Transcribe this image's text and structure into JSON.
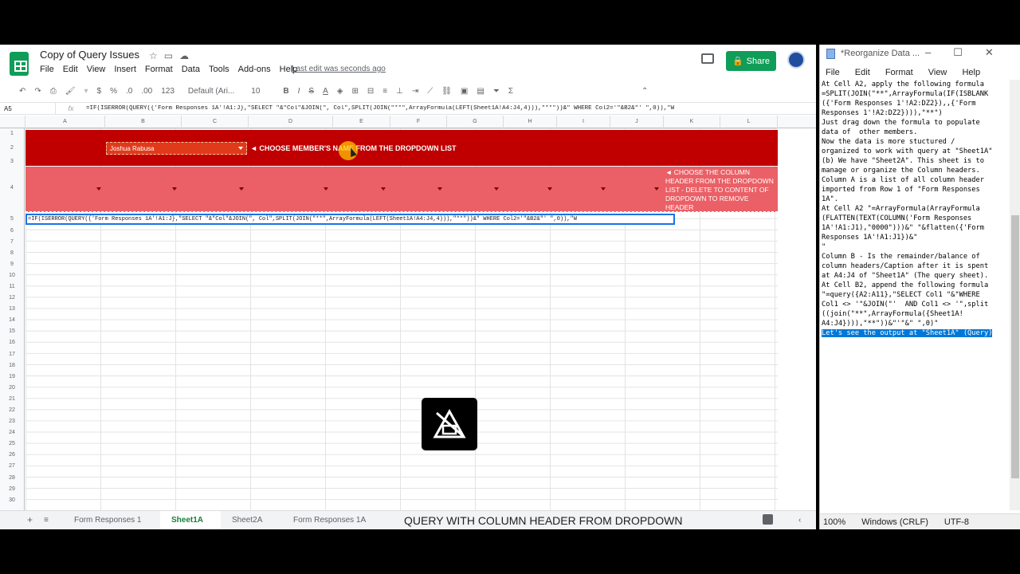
{
  "sheets": {
    "title": "Copy of Query Issues",
    "menu": [
      "File",
      "Edit",
      "View",
      "Insert",
      "Format",
      "Data",
      "Tools",
      "Add-ons",
      "Help"
    ],
    "last_edit": "Last edit was seconds ago",
    "share_label": "Share",
    "toolbar": {
      "font": "Default (Ari...",
      "size": "10",
      "currency": "$",
      "percent": "%",
      "dec_dec": ".0",
      "dec_inc": ".00",
      "format": "123"
    },
    "name_box": "A5",
    "formula": "=IF(ISERROR(QUERY({'Form Responses 1A'!A1:J},\"SELECT \"&\"Col\"&JOIN(\", Col\",SPLIT(JOIN(\"**\",ArrayFormula(LEFT(Sheet1A!A4:J4,4))),\"**\"))&\" WHERE Col2='\"&B2&\"' \",0)),\"W",
    "columns": [
      "A",
      "B",
      "C",
      "D",
      "E",
      "F",
      "G",
      "H",
      "I",
      "J",
      "K",
      "L"
    ],
    "rows": [
      "1",
      "2",
      "3",
      "4",
      "5",
      "6",
      "7",
      "8",
      "9",
      "10",
      "11",
      "12",
      "13",
      "14",
      "15",
      "16",
      "17",
      "18",
      "19",
      "20",
      "21",
      "22",
      "23",
      "24",
      "25",
      "26",
      "27",
      "28",
      "29",
      "30"
    ],
    "dropdown_value": "Joshua Rabusa",
    "instruction_member": "◄  CHOOSE MEMBER'S NAME FROM THE DROPDOWN LIST",
    "instruction_header": "◄  CHOOSE THE COLUMN HEADER FROM THE DROPDOWN LIST - DELETE TO CONTENT OF DROPDOWN TO REMOVE HEADER",
    "cell_a5": "=IF(ISERROR(QUERY({'Form Responses 1A'!A1:J},\"SELECT \"&\"Col\"&JOIN(\", Col\",SPLIT(JOIN(\"**\",ArrayFormula(LEFT(Sheet1A!A4:J4,4))),\"**\"))&\" WHERE Col2='\"&B2&\"' \",0)),\"W",
    "tabs": [
      "Form Responses 1",
      "Sheet1A",
      "Sheet2A",
      "Form Responses 1A"
    ],
    "active_tab": "Sheet1A",
    "caption": "QUERY WITH COLUMN HEADER FROM DROPDOWN"
  },
  "notepad": {
    "title": "*Reorganize Data ...",
    "menu": [
      "File",
      "Edit",
      "Format",
      "View",
      "Help"
    ],
    "lines": [
      "At Cell A2, apply the following formula",
      "",
      "=SPLIT(JOIN(\"**\",ArrayFormula(IF(ISBLANK",
      "({'Form Responses 1'!A2:DZ2}),,{'Form",
      "Responses 1'!A2:DZ2}))),\"**\")",
      "",
      "Just drag down the formula to populate",
      "data of  other members.",
      "",
      "Now the data is more stuctured /",
      "organized to work with query at \"Sheet1A\"",
      "",
      "(b) We have \"Sheet2A\". This sheet is to",
      "manage or organize the Column headers.",
      "Column A is a list of all column header",
      "imported from Row 1 of \"Form Responses",
      "1A\".",
      "",
      "At Cell A2 \"=ArrayFormula(ArrayFormula",
      "(FLATTEN(TEXT(COLUMN('Form Responses",
      "1A'!A1:J1),\"0000\")))&\" \"&flatten({'Form",
      "Responses 1A'!A1:J1})&\"",
      "\"",
      "",
      "Column B - Is the remainder/balance of",
      "column headers/Caption after it is spent",
      "at A4:J4 of \"Sheet1A\" (The query sheet).",
      "At Cell B2, append the following formula",
      "",
      "\"=query({A2:A11},\"SELECT Col1 \"&\"WHERE",
      "Col1 <> '\"&JOIN(\"'  AND Col1 <> '\",split",
      "((join(\"**\",ArrayFormula({Sheet1A!",
      "A4:J4}))),\"**\"))&\"'\"&\" \",0)\"",
      "",
      "Let's see the output at \"Sheet1A\" (Query)"
    ],
    "status": {
      "zoom": "100%",
      "eol": "Windows (CRLF)",
      "encoding": "UTF-8"
    }
  },
  "colors": {
    "band_dark": "#c00000",
    "band_light": "#ea6066",
    "share": "#0f9d58",
    "selection": "#0078d7"
  }
}
